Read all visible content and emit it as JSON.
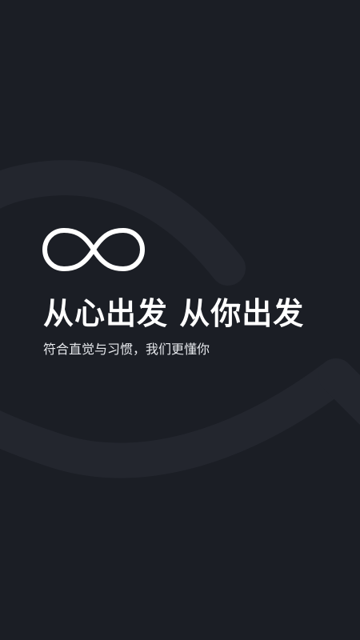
{
  "splash": {
    "logo_icon": "infinity-icon",
    "headline": "从心出发 从你出发",
    "tagline": "符合直觉与习惯，我们更懂你"
  },
  "colors": {
    "background": "#1b1e25",
    "decor": "#23262e",
    "text": "#ffffff"
  }
}
